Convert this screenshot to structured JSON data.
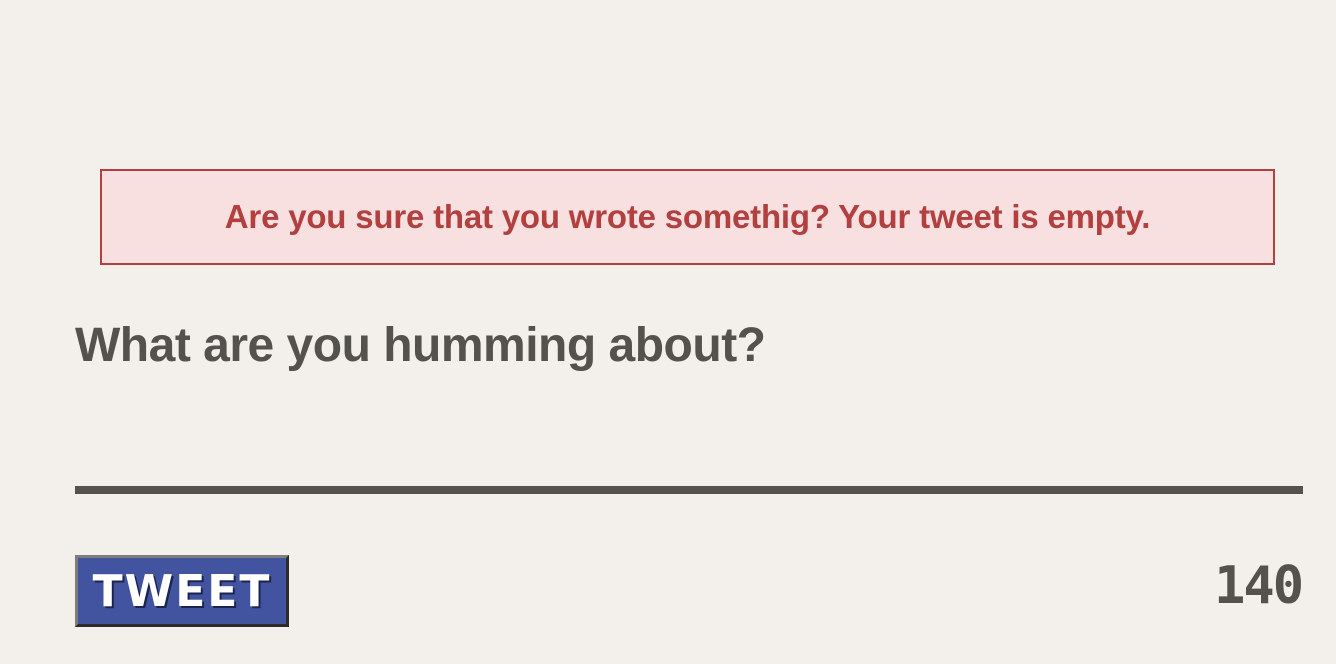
{
  "alert": {
    "message": "Are you sure that you wrote somethig? Your tweet is empty."
  },
  "composer": {
    "prompt": "What are you humming about?",
    "value": "",
    "placeholder": ""
  },
  "tweet_button": {
    "label": "TWEET"
  },
  "char_counter": {
    "remaining": "140"
  },
  "colors": {
    "background": "#f3f0eb",
    "text": "#54524e",
    "alert_text": "#b1403f",
    "alert_background": "#f8dfe0",
    "button_background": "#4254a0"
  }
}
